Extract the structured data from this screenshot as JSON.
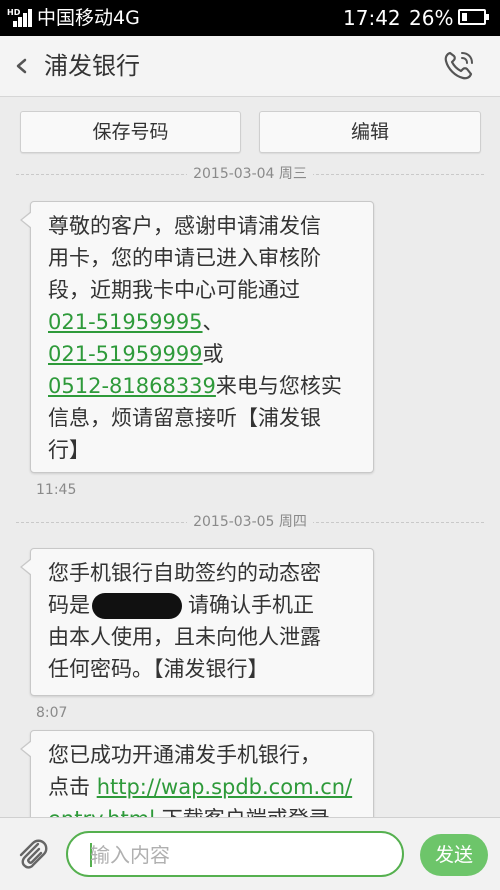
{
  "status_bar": {
    "network_tag": "HD",
    "carrier": "中国移动4G",
    "time": "17:42",
    "battery": "26%",
    "battery_level": 0.26
  },
  "header": {
    "title": "浦发银行",
    "back_icon": "chevron-left-icon",
    "call_icon": "phone-icon"
  },
  "actions": {
    "save_number": "保存号码",
    "edit": "编辑"
  },
  "messages": [
    {
      "date": "2015-03-04 周三",
      "lines": [
        [
          {
            "t": "尊敬的客户，感谢申请浦发信"
          }
        ],
        [
          {
            "t": "用卡，您的申请已进入审核阶"
          }
        ],
        [
          {
            "t": "段，近期我卡中心可能通过"
          }
        ],
        [
          {
            "t": "021-51959995",
            "link": true
          },
          {
            "t": "、"
          }
        ],
        [
          {
            "t": "021-51959999",
            "link": true
          },
          {
            "t": "或"
          }
        ],
        [
          {
            "t": "0512-81868339",
            "link": true
          },
          {
            "t": "来电与您核实"
          }
        ],
        [
          {
            "t": "信息，烦请留意接听【浦发银"
          }
        ],
        [
          {
            "t": "行】"
          }
        ]
      ],
      "time": "11:45"
    },
    {
      "date": "2015-03-05 周四",
      "lines": [
        [
          {
            "t": "您手机银行自助签约的动态密"
          }
        ],
        [
          {
            "t": "码是"
          },
          {
            "redacted": true
          },
          {
            "t": "请确认手机正"
          }
        ],
        [
          {
            "t": "由本人使用，且未向他人泄露"
          }
        ],
        [
          {
            "t": "任何密码。【浦发银行】"
          }
        ]
      ],
      "time": "8:07"
    },
    {
      "lines": [
        [
          {
            "t": "您已成功开通浦发手机银行，"
          }
        ],
        [
          {
            "t": "点击 "
          },
          {
            "t": "http://wap.spdb.com.cn/",
            "link": true
          }
        ],
        [
          {
            "t": "entry.html",
            "link": true
          },
          {
            "t": " 下载客户端或登录"
          }
        ]
      ]
    }
  ],
  "composer": {
    "placeholder": "输入内容",
    "send_label": "发送",
    "attach_icon": "paperclip-icon"
  },
  "colors": {
    "link": "#2e9a3a",
    "accent": "#55b04f",
    "send_button": "#6dc56a"
  }
}
